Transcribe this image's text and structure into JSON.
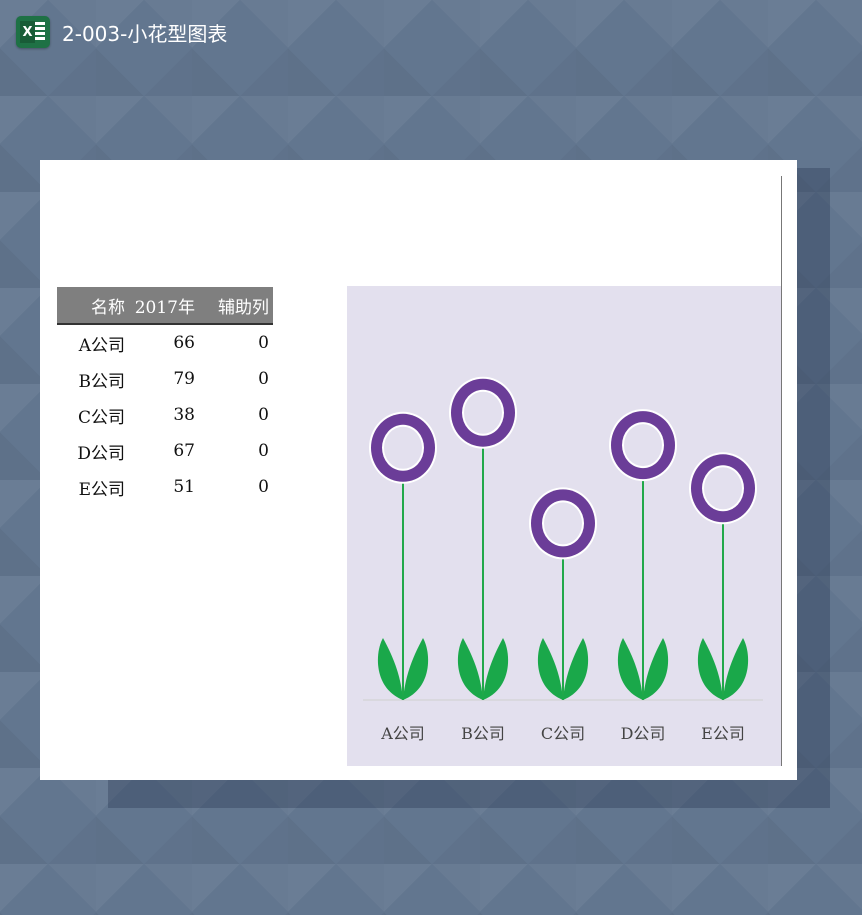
{
  "window": {
    "title": "2-003-小花型图表",
    "icon": "excel-icon"
  },
  "table": {
    "headers": [
      "名称",
      "2017年",
      "辅助列"
    ],
    "rows": [
      [
        "A公司",
        "66",
        "0"
      ],
      [
        "B公司",
        "79",
        "0"
      ],
      [
        "C公司",
        "38",
        "0"
      ],
      [
        "D公司",
        "67",
        "0"
      ],
      [
        "E公司",
        "51",
        "0"
      ]
    ]
  },
  "chart_data": {
    "type": "scatter",
    "categories": [
      "A公司",
      "B公司",
      "C公司",
      "D公司",
      "E公司"
    ],
    "series": [
      {
        "values": [
          66,
          79,
          38,
          67,
          51
        ]
      }
    ],
    "ylim": [
      0,
      100
    ],
    "colors": {
      "flower": "#6b3d98",
      "stem": "#22a84a",
      "leaf": "#1aa84a",
      "background": "#e3e0ee"
    }
  }
}
